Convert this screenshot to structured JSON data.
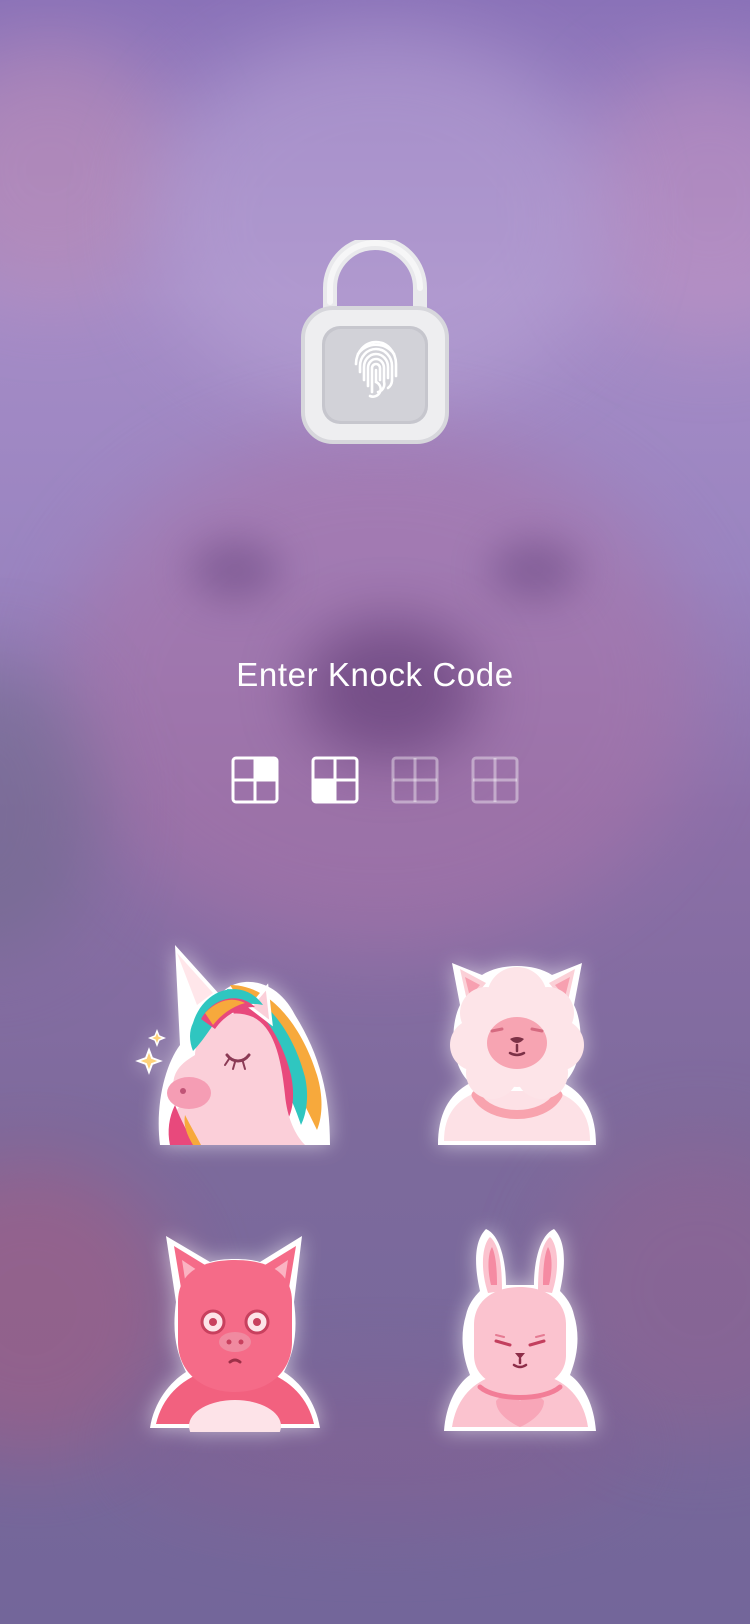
{
  "screen": {
    "prompt": "Enter Knock Code"
  },
  "lock_icon": {
    "icon": "unlocked-padlock-fingerprint-icon",
    "color": "#f2f2f2"
  },
  "code_indicators": [
    {
      "name": "code-indicator-1",
      "state": "entered",
      "filled_quadrant": "top-right"
    },
    {
      "name": "code-indicator-2",
      "state": "entered",
      "filled_quadrant": "bottom-left"
    },
    {
      "name": "code-indicator-3",
      "state": "empty"
    },
    {
      "name": "code-indicator-4",
      "state": "empty"
    }
  ],
  "knock_pads": [
    {
      "name": "unicorn-sticker",
      "position": "top-left"
    },
    {
      "name": "sheep-sticker",
      "position": "top-right"
    },
    {
      "name": "pig-sticker",
      "position": "bottom-left"
    },
    {
      "name": "bunny-sticker",
      "position": "bottom-right"
    }
  ],
  "colors": {
    "background_top": "#8a72b8",
    "background_bottom": "#73669a",
    "text": "#ffffff",
    "sticker_pink": "#f47a92",
    "sticker_light_pink": "#fbc3cf"
  }
}
